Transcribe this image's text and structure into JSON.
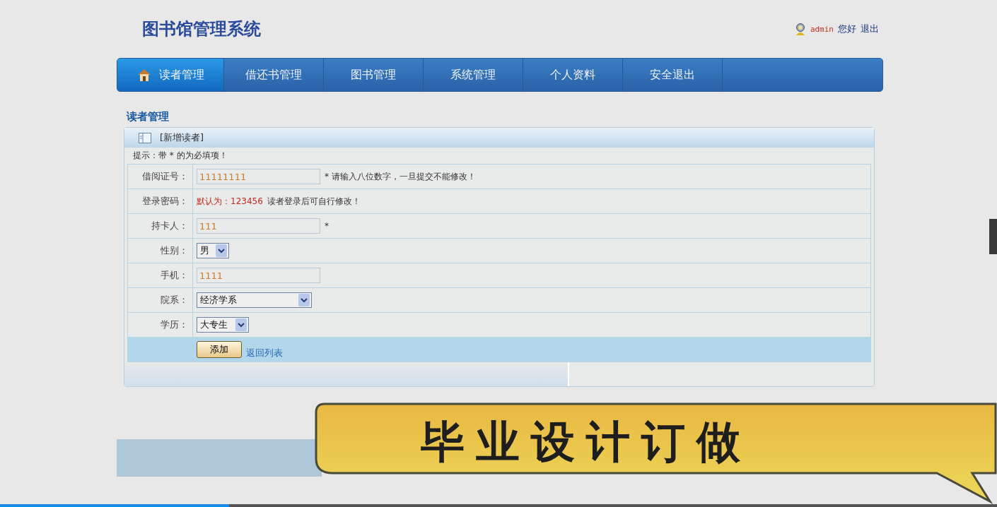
{
  "header": {
    "title": "图书馆管理系统",
    "user": "admin",
    "greeting": "您好",
    "logout": "退出"
  },
  "nav": [
    {
      "label": "读者管理",
      "selected": true
    },
    {
      "label": "借还书管理",
      "selected": false
    },
    {
      "label": "图书管理",
      "selected": false
    },
    {
      "label": "系统管理",
      "selected": false
    },
    {
      "label": "个人资料",
      "selected": false
    },
    {
      "label": "安全退出",
      "selected": false
    }
  ],
  "section_title": "读者管理",
  "panel": {
    "title": "[新增读者]",
    "hint": "提示：带 * 的为必填项！"
  },
  "form_rows": [
    {
      "kind": "input",
      "label": "借阅证号：",
      "value": "11111111",
      "note": "* 请输入八位数字，一旦提交不能修改！"
    },
    {
      "kind": "info",
      "label": "登录密码：",
      "highlight": "默认为：123456",
      "note": "读者登录后可自行修改！"
    },
    {
      "kind": "input",
      "label": "持卡人：",
      "value": "111",
      "note": "*"
    },
    {
      "kind": "select",
      "label": "性别：",
      "value": "男"
    },
    {
      "kind": "input",
      "label": "手机：",
      "value": "1111"
    },
    {
      "kind": "select",
      "label": "院系：",
      "value": "经济学系"
    },
    {
      "kind": "select",
      "label": "学历：",
      "value": "大专生"
    }
  ],
  "actions": {
    "submit": "添加",
    "back": "返回列表"
  },
  "promo_banner": "毕业设计订做",
  "video_progress": {
    "level": 0.23
  }
}
